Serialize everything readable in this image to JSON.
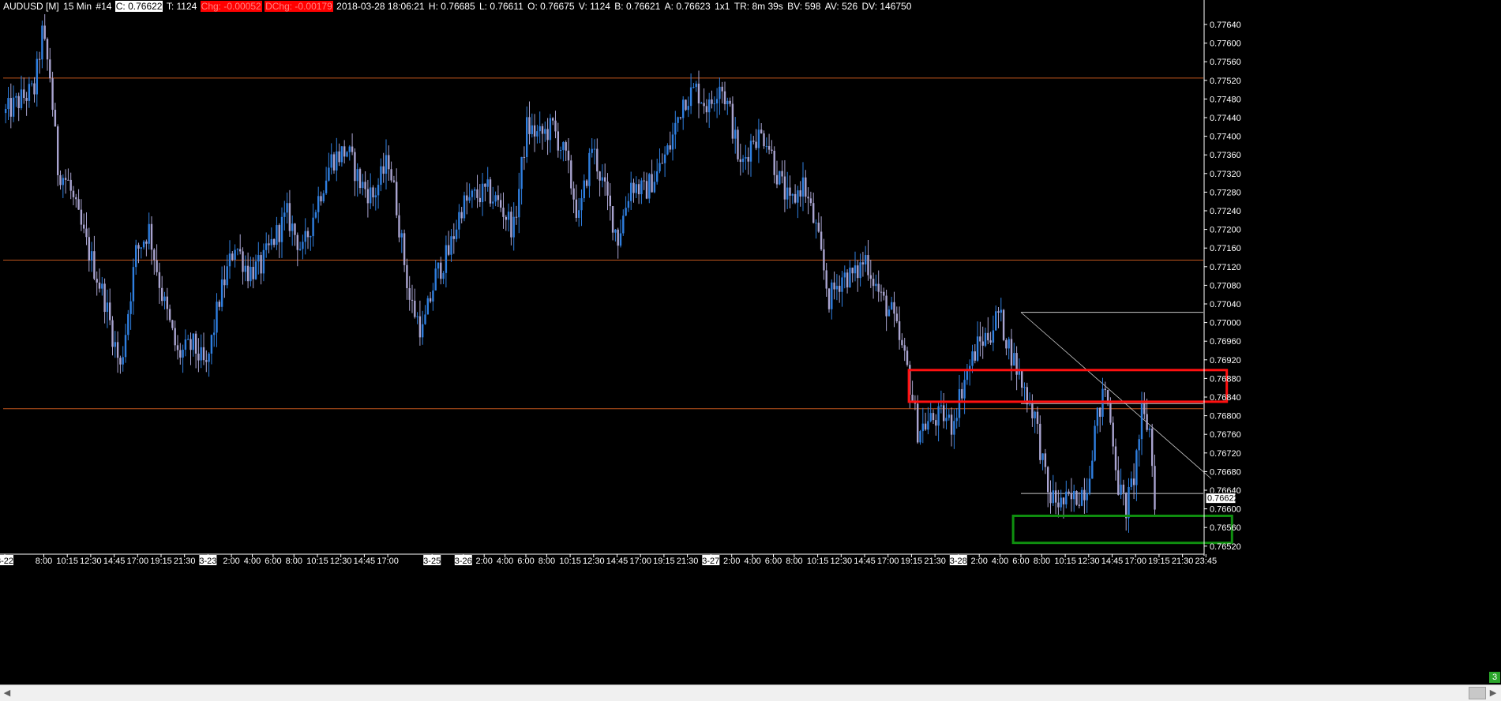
{
  "header": {
    "symbol": "AUDUSD [M]",
    "timeframe": "15 Min",
    "study_count": "#14",
    "close": "C: 0.76622",
    "ticks": "T: 1124",
    "change": "Chg: -0.00052",
    "daily_change": "DChg: -0.00179",
    "timestamp": "2018-03-28 18:06:21",
    "high": "H: 0.76685",
    "low": "L: 0.76611",
    "open": "O: 0.76675",
    "volume": "V: 1124",
    "bid": "B: 0.76621",
    "ask": "A: 0.76623",
    "size": "1x1",
    "time_remaining": "TR: 8m 39s",
    "bar_volume": "BV: 598",
    "avg_volume": "AV: 526",
    "daily_volume": "DV: 146750"
  },
  "colors": {
    "background": "#000000",
    "bull": "#2f7fe0",
    "bear": "#a9a4d0",
    "horizontal_level": "#c0561e",
    "supply_zone": "#ff1010",
    "demand_zone": "#0f8f0f",
    "trendline": "#c8c8c8",
    "axis_text": "#ffffff",
    "negative_badge": "#ff0000"
  },
  "price_tag": "0.76622",
  "corner_badge": "3",
  "chart_data": {
    "type": "candlestick",
    "title": "",
    "xlabel": "",
    "ylabel": "",
    "ylim": [
      0.7652,
      0.7768
    ],
    "grid": false,
    "y_ticks": [
      "0.77640",
      "0.77600",
      "0.77560",
      "0.77520",
      "0.77480",
      "0.77440",
      "0.77400",
      "0.77360",
      "0.77320",
      "0.77280",
      "0.77240",
      "0.77200",
      "0.77160",
      "0.77120",
      "0.77080",
      "0.77040",
      "0.77000",
      "0.76960",
      "0.76920",
      "0.76880",
      "0.76840",
      "0.76800",
      "0.76760",
      "0.76720",
      "0.76680",
      "0.76640",
      "0.76600",
      "0.76560",
      "0.76520"
    ],
    "x_ticks": [
      {
        "label": "3-22",
        "bar": 0,
        "boxed": true
      },
      {
        "label": "8:00",
        "bar": 15
      },
      {
        "label": "10:15",
        "bar": 24
      },
      {
        "label": "12:30",
        "bar": 33
      },
      {
        "label": "14:45",
        "bar": 42
      },
      {
        "label": "17:00",
        "bar": 51
      },
      {
        "label": "19:15",
        "bar": 60
      },
      {
        "label": "21:30",
        "bar": 69
      },
      {
        "label": "3-23",
        "bar": 78,
        "boxed": true
      },
      {
        "label": "2:00",
        "bar": 87
      },
      {
        "label": "4:00",
        "bar": 95
      },
      {
        "label": "6:00",
        "bar": 103
      },
      {
        "label": "8:00",
        "bar": 111
      },
      {
        "label": "10:15",
        "bar": 120
      },
      {
        "label": "12:30",
        "bar": 129
      },
      {
        "label": "14:45",
        "bar": 138
      },
      {
        "label": "17:00",
        "bar": 147
      },
      {
        "label": "3-25",
        "bar": 164,
        "boxed": true
      },
      {
        "label": "3-26",
        "bar": 176,
        "boxed": true
      },
      {
        "label": "2:00",
        "bar": 184
      },
      {
        "label": "4:00",
        "bar": 192
      },
      {
        "label": "6:00",
        "bar": 200
      },
      {
        "label": "8:00",
        "bar": 208
      },
      {
        "label": "10:15",
        "bar": 217
      },
      {
        "label": "12:30",
        "bar": 226
      },
      {
        "label": "14:45",
        "bar": 235
      },
      {
        "label": "17:00",
        "bar": 244
      },
      {
        "label": "19:15",
        "bar": 253
      },
      {
        "label": "21:30",
        "bar": 262
      },
      {
        "label": "3-27",
        "bar": 271,
        "boxed": true
      },
      {
        "label": "2:00",
        "bar": 279
      },
      {
        "label": "4:00",
        "bar": 287
      },
      {
        "label": "6:00",
        "bar": 295
      },
      {
        "label": "8:00",
        "bar": 303
      },
      {
        "label": "10:15",
        "bar": 312
      },
      {
        "label": "12:30",
        "bar": 321
      },
      {
        "label": "14:45",
        "bar": 330
      },
      {
        "label": "17:00",
        "bar": 339
      },
      {
        "label": "19:15",
        "bar": 348
      },
      {
        "label": "21:30",
        "bar": 357
      },
      {
        "label": "3-28",
        "bar": 366,
        "boxed": true
      },
      {
        "label": "2:00",
        "bar": 374
      },
      {
        "label": "4:00",
        "bar": 382
      },
      {
        "label": "6:00",
        "bar": 390
      },
      {
        "label": "8:00",
        "bar": 398
      },
      {
        "label": "10:15",
        "bar": 407
      },
      {
        "label": "12:30",
        "bar": 416
      },
      {
        "label": "14:45",
        "bar": 425
      },
      {
        "label": "17:00",
        "bar": 434
      },
      {
        "label": "19:15",
        "bar": 443
      },
      {
        "label": "21:30",
        "bar": 452
      },
      {
        "label": "23:45",
        "bar": 461
      }
    ],
    "bar_count": 442,
    "price_path": [
      [
        0,
        0.7745
      ],
      [
        6,
        0.7748
      ],
      [
        11,
        0.775
      ],
      [
        14,
        0.7762
      ],
      [
        17,
        0.7753
      ],
      [
        20,
        0.7733
      ],
      [
        24,
        0.773
      ],
      [
        28,
        0.7722
      ],
      [
        32,
        0.7715
      ],
      [
        38,
        0.7705
      ],
      [
        44,
        0.769
      ],
      [
        50,
        0.7715
      ],
      [
        55,
        0.772
      ],
      [
        60,
        0.7706
      ],
      [
        66,
        0.7693
      ],
      [
        72,
        0.7695
      ],
      [
        77,
        0.769
      ],
      [
        82,
        0.7705
      ],
      [
        88,
        0.7717
      ],
      [
        93,
        0.7711
      ],
      [
        98,
        0.7712
      ],
      [
        103,
        0.7718
      ],
      [
        108,
        0.7723
      ],
      [
        114,
        0.7715
      ],
      [
        119,
        0.7725
      ],
      [
        125,
        0.7735
      ],
      [
        131,
        0.7737
      ],
      [
        136,
        0.773
      ],
      [
        141,
        0.7727
      ],
      [
        147,
        0.7735
      ],
      [
        150,
        0.7725
      ],
      [
        155,
        0.7705
      ],
      [
        160,
        0.7698
      ],
      [
        165,
        0.771
      ],
      [
        170,
        0.7715
      ],
      [
        175,
        0.7725
      ],
      [
        180,
        0.7727
      ],
      [
        185,
        0.7728
      ],
      [
        190,
        0.7725
      ],
      [
        195,
        0.772
      ],
      [
        200,
        0.7742
      ],
      [
        205,
        0.774
      ],
      [
        210,
        0.7742
      ],
      [
        215,
        0.7735
      ],
      [
        220,
        0.7722
      ],
      [
        225,
        0.7738
      ],
      [
        230,
        0.7728
      ],
      [
        235,
        0.7718
      ],
      [
        240,
        0.773
      ],
      [
        245,
        0.7728
      ],
      [
        250,
        0.7732
      ],
      [
        255,
        0.7738
      ],
      [
        260,
        0.7748
      ],
      [
        265,
        0.775
      ],
      [
        270,
        0.7746
      ],
      [
        274,
        0.7752
      ],
      [
        278,
        0.7745
      ],
      [
        282,
        0.7733
      ],
      [
        287,
        0.774
      ],
      [
        292,
        0.774
      ],
      [
        296,
        0.7732
      ],
      [
        301,
        0.7725
      ],
      [
        306,
        0.773
      ],
      [
        311,
        0.772
      ],
      [
        316,
        0.7705
      ],
      [
        321,
        0.771
      ],
      [
        326,
        0.771
      ],
      [
        330,
        0.7714
      ],
      [
        336,
        0.7705
      ],
      [
        340,
        0.7702
      ],
      [
        346,
        0.769
      ],
      [
        350,
        0.7677
      ],
      [
        355,
        0.7679
      ],
      [
        360,
        0.768
      ],
      [
        363,
        0.7678
      ],
      [
        368,
        0.7688
      ],
      [
        373,
        0.7695
      ],
      [
        378,
        0.7698
      ],
      [
        381,
        0.7702
      ],
      [
        385,
        0.7695
      ],
      [
        390,
        0.7687
      ],
      [
        395,
        0.768
      ],
      [
        400,
        0.7663
      ],
      [
        405,
        0.7661
      ],
      [
        410,
        0.7662
      ],
      [
        415,
        0.7665
      ],
      [
        418,
        0.7677
      ],
      [
        422,
        0.7686
      ],
      [
        425,
        0.7675
      ],
      [
        427,
        0.7665
      ],
      [
        430,
        0.766
      ],
      [
        433,
        0.7667
      ],
      [
        436,
        0.768
      ],
      [
        439,
        0.7677
      ],
      [
        441,
        0.7662
      ]
    ],
    "horizontal_levels": [
      0.77525,
      0.77134,
      0.76815
    ],
    "short_levels": [
      {
        "price": 0.77022,
        "from_bar": 390
      },
      {
        "price": 0.76826,
        "from_bar": 390
      },
      {
        "price": 0.76633,
        "from_bar": 390
      }
    ],
    "trendline": {
      "from": {
        "bar": 390,
        "price": 0.77022
      },
      "to": {
        "bar": 463,
        "price": 0.76665
      }
    },
    "zones": [
      {
        "name": "supply-zone",
        "color": "red",
        "bar_start": 347,
        "bar_end": 469,
        "price_high": 0.76898,
        "price_low": 0.7683
      },
      {
        "name": "demand-zone",
        "color": "green",
        "bar_start": 387,
        "bar_end": 471,
        "price_high": 0.76585,
        "price_low": 0.76527
      }
    ],
    "last_price": 0.76622
  }
}
